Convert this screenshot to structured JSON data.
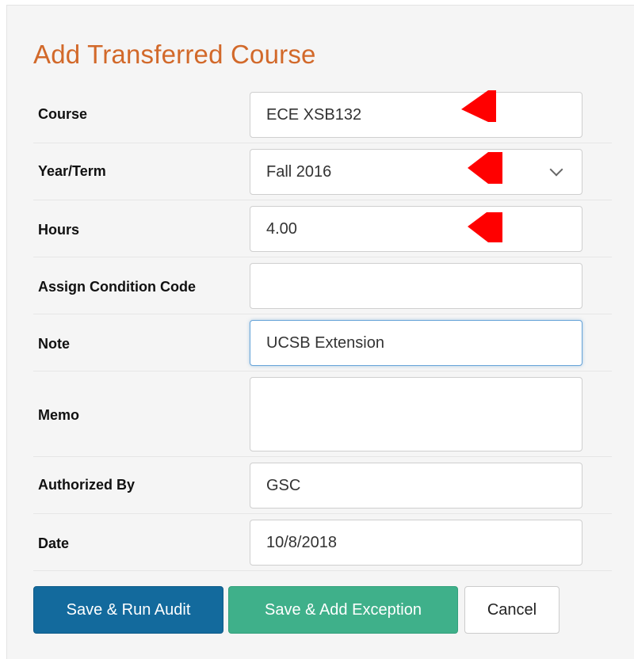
{
  "form": {
    "title": "Add Transferred Course",
    "fields": [
      {
        "label": "Course",
        "value": ""
      },
      {
        "label": "Year/Term",
        "value": "Fall 2016"
      },
      {
        "label": "Hours",
        "value": "4.00"
      },
      {
        "label": "Assign Condition Code",
        "value": ""
      },
      {
        "label": "Note",
        "value": "UCSB Extension"
      },
      {
        "label": "Memo",
        "value": ""
      },
      {
        "label": "Authorized By",
        "value": "GSC"
      },
      {
        "label": "Date",
        "value": "10/8/2018"
      }
    ],
    "course_value": "ECE XSB132"
  },
  "buttons": {
    "save_run_audit": "Save & Run Audit",
    "save_add_exception": "Save & Add Exception",
    "cancel": "Cancel"
  },
  "colors": {
    "title": "#d2692a",
    "primary": "#136a9d",
    "success": "#3fb08a",
    "marker": "#ff0000"
  }
}
